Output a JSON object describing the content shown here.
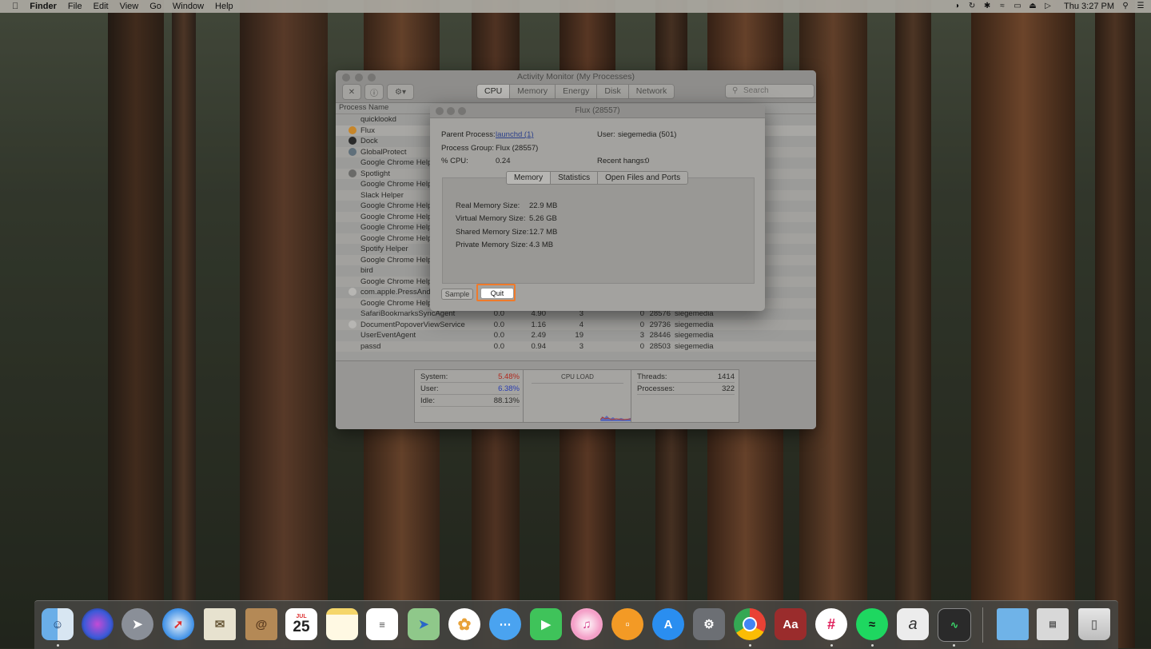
{
  "menubar": {
    "apple": "",
    "items": [
      "Finder",
      "File",
      "Edit",
      "View",
      "Go",
      "Window",
      "Help"
    ],
    "clock": "Thu 3:27 PM",
    "status_icons": [
      "flux-icon",
      "sync-icon",
      "bluetooth-icon",
      "wifi-icon",
      "airplay-icon",
      "eject-icon",
      "volume-icon",
      "spotlight-icon",
      "notification-center-icon"
    ]
  },
  "activity_monitor": {
    "title": "Activity Monitor (My Processes)",
    "tabs": [
      "CPU",
      "Memory",
      "Energy",
      "Disk",
      "Network"
    ],
    "active_tab": "CPU",
    "search_placeholder": "Search",
    "column_process_name": "Process Name",
    "processes": [
      {
        "name": "quicklookd",
        "icon": "",
        "cpu": "",
        "time": "",
        "threads": "",
        "wakes": "",
        "pid": "",
        "user": ""
      },
      {
        "name": "Flux",
        "icon": "flux-icon",
        "cpu": "",
        "time": "",
        "threads": "",
        "wakes": "",
        "pid": "",
        "user": ""
      },
      {
        "name": "Dock",
        "icon": "dock-icon",
        "cpu": "",
        "time": "",
        "threads": "",
        "wakes": "",
        "pid": "",
        "user": ""
      },
      {
        "name": "GlobalProtect",
        "icon": "globalprotect-icon",
        "cpu": "",
        "time": "",
        "threads": "",
        "wakes": "",
        "pid": "",
        "user": ""
      },
      {
        "name": "Google Chrome Helpe",
        "icon": "",
        "cpu": "",
        "time": "",
        "threads": "",
        "wakes": "",
        "pid": "",
        "user": ""
      },
      {
        "name": "Spotlight",
        "icon": "spotlight-icon",
        "cpu": "",
        "time": "",
        "threads": "",
        "wakes": "",
        "pid": "",
        "user": ""
      },
      {
        "name": "Google Chrome Helpe",
        "icon": "",
        "cpu": "",
        "time": "",
        "threads": "",
        "wakes": "",
        "pid": "",
        "user": ""
      },
      {
        "name": "Slack Helper",
        "icon": "",
        "cpu": "",
        "time": "",
        "threads": "",
        "wakes": "",
        "pid": "",
        "user": ""
      },
      {
        "name": "Google Chrome Helpe",
        "icon": "",
        "cpu": "",
        "time": "",
        "threads": "",
        "wakes": "",
        "pid": "",
        "user": ""
      },
      {
        "name": "Google Chrome Helpe",
        "icon": "",
        "cpu": "",
        "time": "",
        "threads": "",
        "wakes": "",
        "pid": "",
        "user": ""
      },
      {
        "name": "Google Chrome Helpe",
        "icon": "",
        "cpu": "",
        "time": "",
        "threads": "",
        "wakes": "",
        "pid": "",
        "user": ""
      },
      {
        "name": "Google Chrome Helpe",
        "icon": "",
        "cpu": "",
        "time": "",
        "threads": "",
        "wakes": "",
        "pid": "",
        "user": ""
      },
      {
        "name": "Spotify Helper",
        "icon": "",
        "cpu": "",
        "time": "",
        "threads": "",
        "wakes": "",
        "pid": "",
        "user": ""
      },
      {
        "name": "Google Chrome Helpe",
        "icon": "",
        "cpu": "",
        "time": "",
        "threads": "",
        "wakes": "",
        "pid": "",
        "user": ""
      },
      {
        "name": "bird",
        "icon": "",
        "cpu": "",
        "time": "",
        "threads": "",
        "wakes": "",
        "pid": "",
        "user": ""
      },
      {
        "name": "Google Chrome Helpe",
        "icon": "",
        "cpu": "",
        "time": "",
        "threads": "",
        "wakes": "",
        "pid": "",
        "user": ""
      },
      {
        "name": "com.apple.PressAndH",
        "icon": "generic-app-icon",
        "cpu": "",
        "time": "",
        "threads": "",
        "wakes": "",
        "pid": "",
        "user": ""
      },
      {
        "name": "Google Chrome Helpe",
        "icon": "",
        "cpu": "",
        "time": "",
        "threads": "",
        "wakes": "",
        "pid": "",
        "user": ""
      },
      {
        "name": "SafariBookmarksSyncAgent",
        "icon": "",
        "cpu": "0.0",
        "time": "4.90",
        "threads": "3",
        "wakes": "0",
        "pid": "28576",
        "user": "siegemedia"
      },
      {
        "name": "DocumentPopoverViewService",
        "icon": "generic-app-icon",
        "cpu": "0.0",
        "time": "1.16",
        "threads": "4",
        "wakes": "0",
        "pid": "29736",
        "user": "siegemedia"
      },
      {
        "name": "UserEventAgent",
        "icon": "",
        "cpu": "0.0",
        "time": "2.49",
        "threads": "19",
        "wakes": "3",
        "pid": "28446",
        "user": "siegemedia"
      },
      {
        "name": "passd",
        "icon": "",
        "cpu": "0.0",
        "time": "0.94",
        "threads": "3",
        "wakes": "0",
        "pid": "28503",
        "user": "siegemedia"
      }
    ],
    "stats": {
      "system_label": "System:",
      "system_value": "5.48%",
      "user_label": "User:",
      "user_value": "6.38%",
      "idle_label": "Idle:",
      "idle_value": "88.13%",
      "cpu_load_label": "CPU LOAD",
      "threads_label": "Threads:",
      "threads_value": "1414",
      "processes_label": "Processes:",
      "processes_value": "322"
    }
  },
  "flux_dialog": {
    "title": "Flux (28557)",
    "parent_process_label": "Parent Process:",
    "parent_process_value": "launchd (1)",
    "user_label": "User:",
    "user_value": "siegemedia (501)",
    "process_group_label": "Process Group:",
    "process_group_value": "Flux (28557)",
    "cpu_label": "% CPU:",
    "cpu_value": "0.24",
    "recent_hangs_label": "Recent hangs:",
    "recent_hangs_value": "0",
    "tabs": [
      "Memory",
      "Statistics",
      "Open Files and Ports"
    ],
    "active_tab": "Memory",
    "real_memory_label": "Real Memory Size:",
    "real_memory_value": "22.9 MB",
    "virtual_memory_label": "Virtual Memory Size:",
    "virtual_memory_value": "5.26 GB",
    "shared_memory_label": "Shared Memory Size:",
    "shared_memory_value": "12.7 MB",
    "private_memory_label": "Private Memory Size:",
    "private_memory_value": "4.3 MB",
    "sample_button": "Sample",
    "quit_button": "Quit",
    "highlight_color": "#f07a2a"
  },
  "dock": {
    "calendar_month": "JUL",
    "calendar_day": "25",
    "dictionary_label": "Aa",
    "items": [
      "finder-icon",
      "siri-icon",
      "launchpad-icon",
      "safari-icon",
      "mail-icon",
      "contacts-icon",
      "calendar-icon",
      "notes-icon",
      "reminders-icon",
      "maps-icon",
      "photos-icon",
      "messages-icon",
      "facetime-icon",
      "itunes-icon",
      "ibooks-icon",
      "app-store-icon",
      "system-preferences-icon",
      "chrome-icon",
      "dictionary-icon",
      "slack-icon",
      "spotify-icon",
      "script-editor-icon",
      "activity-monitor-icon",
      "downloads-folder-icon",
      "documents-icon",
      "trash-icon"
    ]
  }
}
